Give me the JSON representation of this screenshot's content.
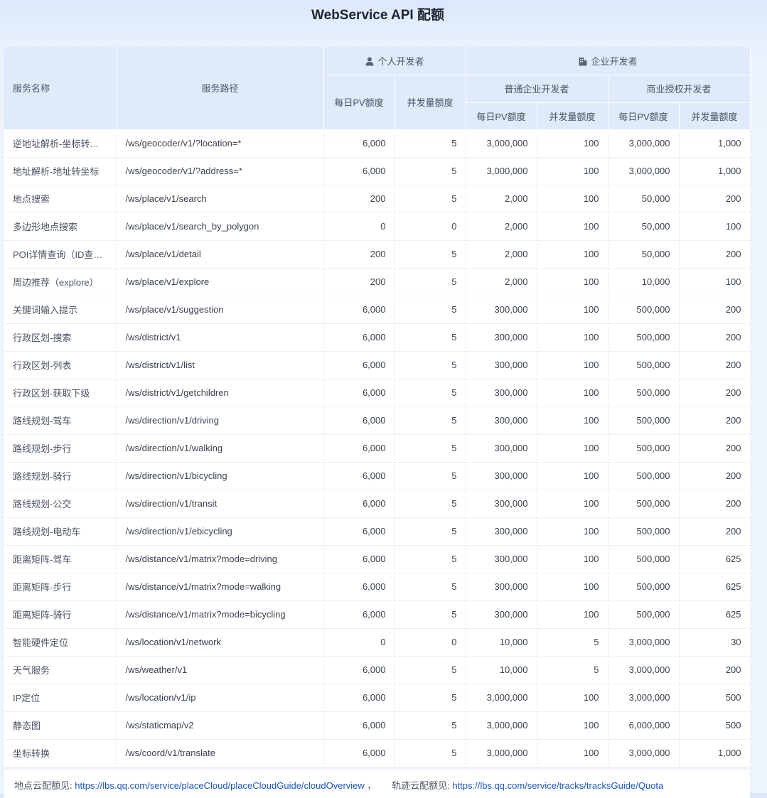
{
  "title": "WebService API 配额",
  "headers": {
    "name": "服务名称",
    "path": "服务路径",
    "personal": "个人开发者",
    "enterprise": "企业开发者",
    "normal": "普通企业开发者",
    "commercial": "商业授权开发者",
    "daily_pv": "每日PV额度",
    "concurrency": "并发量额度"
  },
  "icons": {
    "personal": "person-icon",
    "enterprise": "building-icon"
  },
  "rows": [
    [
      "逆地址解析-坐标转地址",
      "/ws/geocoder/v1/?location=*",
      "6,000",
      "5",
      "3,000,000",
      "100",
      "3,000,000",
      "1,000"
    ],
    [
      "地址解析-地址转坐标",
      "/ws/geocoder/v1/?address=*",
      "6,000",
      "5",
      "3,000,000",
      "100",
      "3,000,000",
      "1,000"
    ],
    [
      "地点搜索",
      "/ws/place/v1/search",
      "200",
      "5",
      "2,000",
      "100",
      "50,000",
      "200"
    ],
    [
      "多边形地点搜索",
      "/ws/place/v1/search_by_polygon",
      "0",
      "0",
      "2,000",
      "100",
      "50,000",
      "100"
    ],
    [
      "POI详情查询（ID查询）",
      "/ws/place/v1/detail",
      "200",
      "5",
      "2,000",
      "100",
      "50,000",
      "200"
    ],
    [
      "周边推荐（explore）",
      "/ws/place/v1/explore",
      "200",
      "5",
      "2,000",
      "100",
      "10,000",
      "100"
    ],
    [
      "关键词输入提示",
      "/ws/place/v1/suggestion",
      "6,000",
      "5",
      "300,000",
      "100",
      "500,000",
      "200"
    ],
    [
      "行政区划-搜索",
      "/ws/district/v1",
      "6,000",
      "5",
      "300,000",
      "100",
      "500,000",
      "200"
    ],
    [
      "行政区划-列表",
      "/ws/district/v1/list",
      "6,000",
      "5",
      "300,000",
      "100",
      "500,000",
      "200"
    ],
    [
      "行政区划-获取下级",
      "/ws/district/v1/getchildren",
      "6,000",
      "5",
      "300,000",
      "100",
      "500,000",
      "200"
    ],
    [
      "路线规划-驾车",
      "/ws/direction/v1/driving",
      "6,000",
      "5",
      "300,000",
      "100",
      "500,000",
      "200"
    ],
    [
      "路线规划-步行",
      "/ws/direction/v1/walking",
      "6,000",
      "5",
      "300,000",
      "100",
      "500,000",
      "200"
    ],
    [
      "路线规划-骑行",
      "/ws/direction/v1/bicycling",
      "6,000",
      "5",
      "300,000",
      "100",
      "500,000",
      "200"
    ],
    [
      "路线规划-公交",
      "/ws/direction/v1/transit",
      "6,000",
      "5",
      "300,000",
      "100",
      "500,000",
      "200"
    ],
    [
      "路线规划-电动车",
      "/ws/direction/v1/ebicycling",
      "6,000",
      "5",
      "300,000",
      "100",
      "500,000",
      "200"
    ],
    [
      "距离矩阵-驾车",
      "/ws/distance/v1/matrix?mode=driving",
      "6,000",
      "5",
      "300,000",
      "100",
      "500,000",
      "625"
    ],
    [
      "距离矩阵-步行",
      "/ws/distance/v1/matrix?mode=walking",
      "6,000",
      "5",
      "300,000",
      "100",
      "500,000",
      "625"
    ],
    [
      "距离矩阵-骑行",
      "/ws/distance/v1/matrix?mode=bicycling",
      "6,000",
      "5",
      "300,000",
      "100",
      "500,000",
      "625"
    ],
    [
      "智能硬件定位",
      "/ws/location/v1/network",
      "0",
      "0",
      "10,000",
      "5",
      "3,000,000",
      "30"
    ],
    [
      "天气服务",
      "/ws/weather/v1",
      "6,000",
      "5",
      "10,000",
      "5",
      "3,000,000",
      "200"
    ],
    [
      "IP定位",
      "/ws/location/v1/ip",
      "6,000",
      "5",
      "3,000,000",
      "100",
      "3,000,000",
      "500"
    ],
    [
      "静态图",
      "/ws/staticmap/v2",
      "6,000",
      "5",
      "3,000,000",
      "100",
      "6,000,000",
      "500"
    ],
    [
      "坐标转换",
      "/ws/coord/v1/translate",
      "6,000",
      "5",
      "3,000,000",
      "100",
      "3,000,000",
      "1,000"
    ]
  ],
  "footer": {
    "place_label": "地点云配额见:",
    "place_link": "https://lbs.qq.com/service/placeCloud/placeCloudGuide/cloudOverview",
    "separator": "，",
    "track_label": "轨迹云配额见:",
    "track_link": "https://lbs.qq.com/service/tracks/tracksGuide/Quota"
  }
}
